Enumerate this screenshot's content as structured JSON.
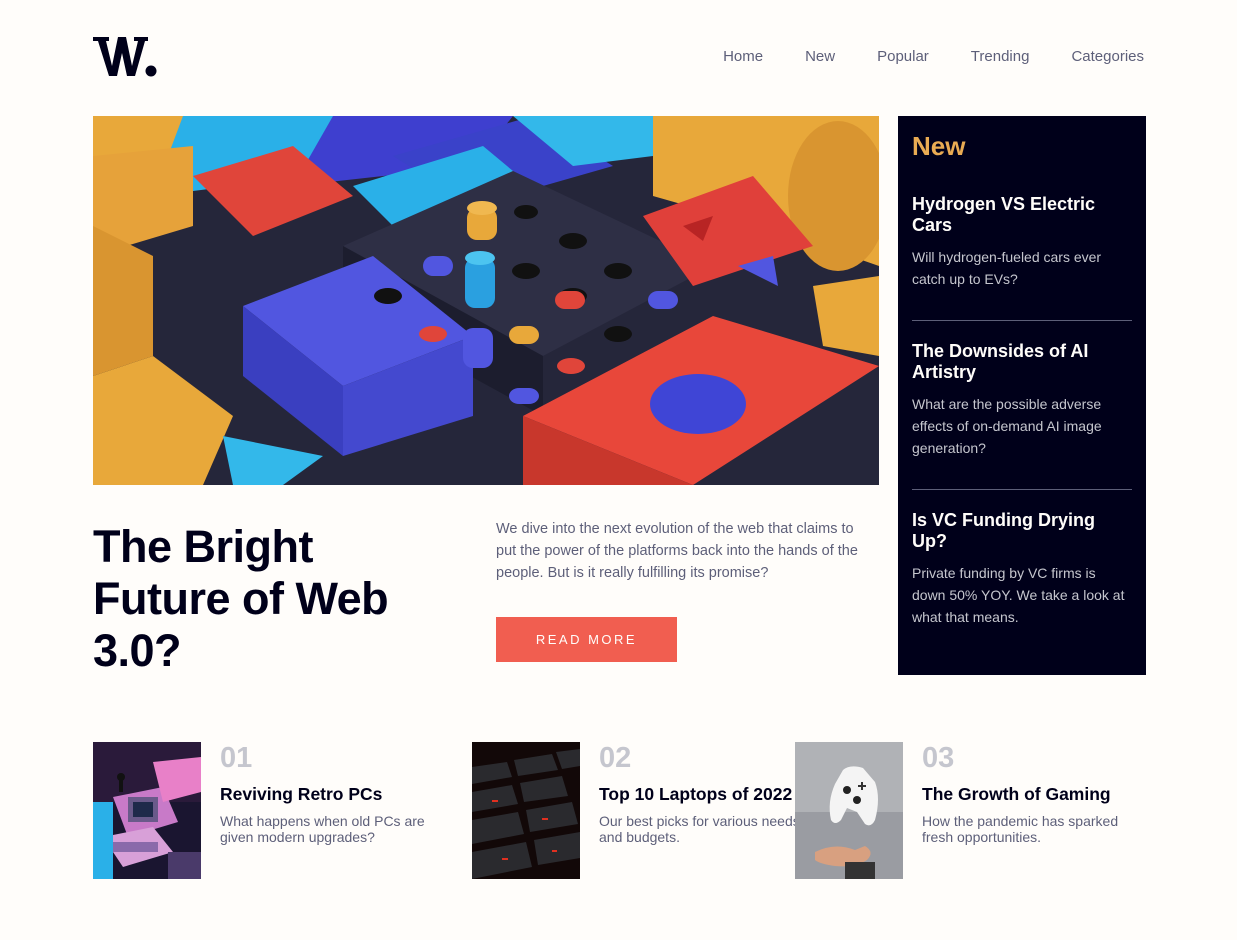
{
  "brand": {
    "logo_text": "W."
  },
  "nav": {
    "items": [
      "Home",
      "New",
      "Popular",
      "Trending",
      "Categories"
    ]
  },
  "hero": {
    "image_alt": "Abstract 3D board game blocks",
    "title": "The Bright Future of Web 3.0?",
    "description": "We dive into the next evolution of the web that claims to put the power of the platforms back into the hands of the people. But is it really fulfilling its promise?",
    "button_label": "READ MORE"
  },
  "new_panel": {
    "heading": "New",
    "items": [
      {
        "title": "Hydrogen VS Electric Cars",
        "desc": "Will hydrogen-fueled cars ever catch up to EVs?"
      },
      {
        "title": "The Downsides of AI Artistry",
        "desc": "What are the possible adverse effects of on-demand AI image generation?"
      },
      {
        "title": "Is VC Funding Drying Up?",
        "desc": "Private funding by VC firms is down 50% YOY. We take a look at what that means."
      }
    ]
  },
  "cards": [
    {
      "num": "01",
      "title": "Reviving Retro PCs",
      "desc": "What happens when old PCs are given modern upgrades?",
      "image": "retro-pc-image"
    },
    {
      "num": "02",
      "title": "Top 10 Laptops of 2022",
      "desc": "Our best picks for various needs and budgets.",
      "image": "laptop-keyboard-image"
    },
    {
      "num": "03",
      "title": "The Growth of Gaming",
      "desc": "How the pandemic has sparked fresh opportunities.",
      "image": "game-controller-image"
    }
  ],
  "colors": {
    "background": "#fffdfa",
    "dark": "#00001a",
    "accent_red": "#f15e50",
    "accent_orange": "#e9ab53",
    "grayish": "#5d5f79",
    "light_gray": "#c5c6ce"
  }
}
